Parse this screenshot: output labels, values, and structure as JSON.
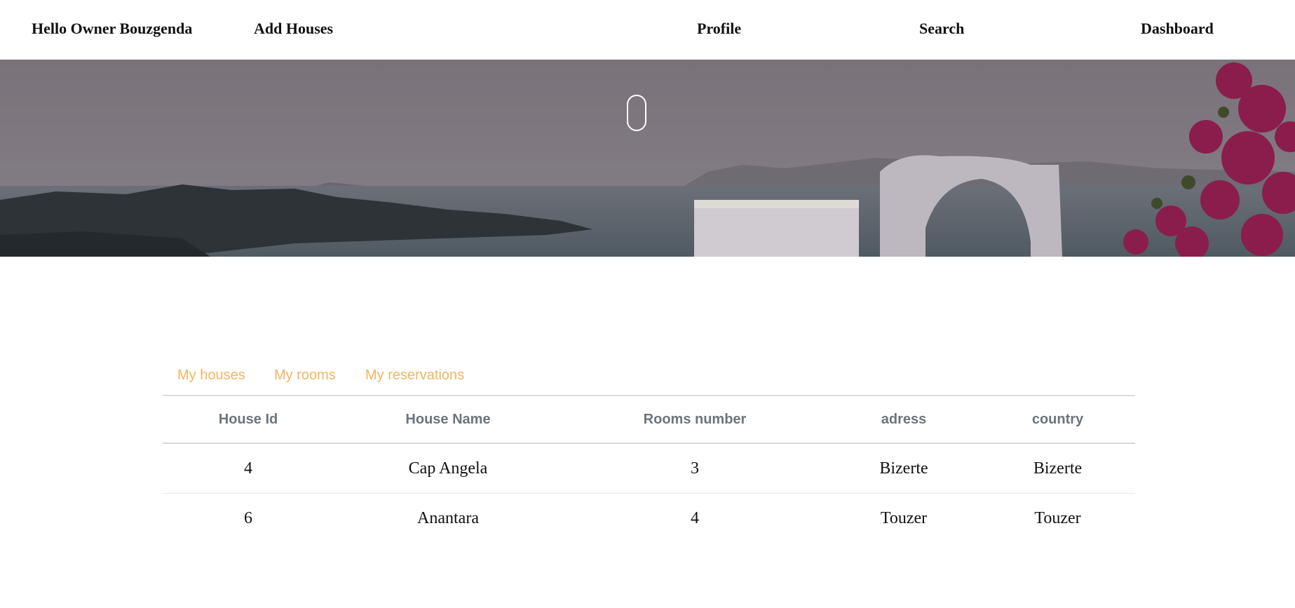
{
  "nav": {
    "greeting": "Hello Owner Bouzgenda",
    "add_houses": "Add Houses",
    "profile": "Profile",
    "search": "Search",
    "dashboard": "Dashboard"
  },
  "tabs": {
    "houses": "My houses",
    "rooms": "My rooms",
    "reservations": "My reservations"
  },
  "table": {
    "columns": [
      "House Id",
      "House Name",
      "Rooms number",
      "adress",
      "country"
    ],
    "rows": [
      [
        "4",
        "Cap Angela",
        "3",
        "Bizerte",
        "Bizerte"
      ],
      [
        "6",
        "Anantara",
        "4",
        "Touzer",
        "Touzer"
      ]
    ]
  },
  "colors": {
    "tab_accent": "#f2b560",
    "header_text": "#6c757d",
    "hero_overlay": "#6e6672"
  }
}
